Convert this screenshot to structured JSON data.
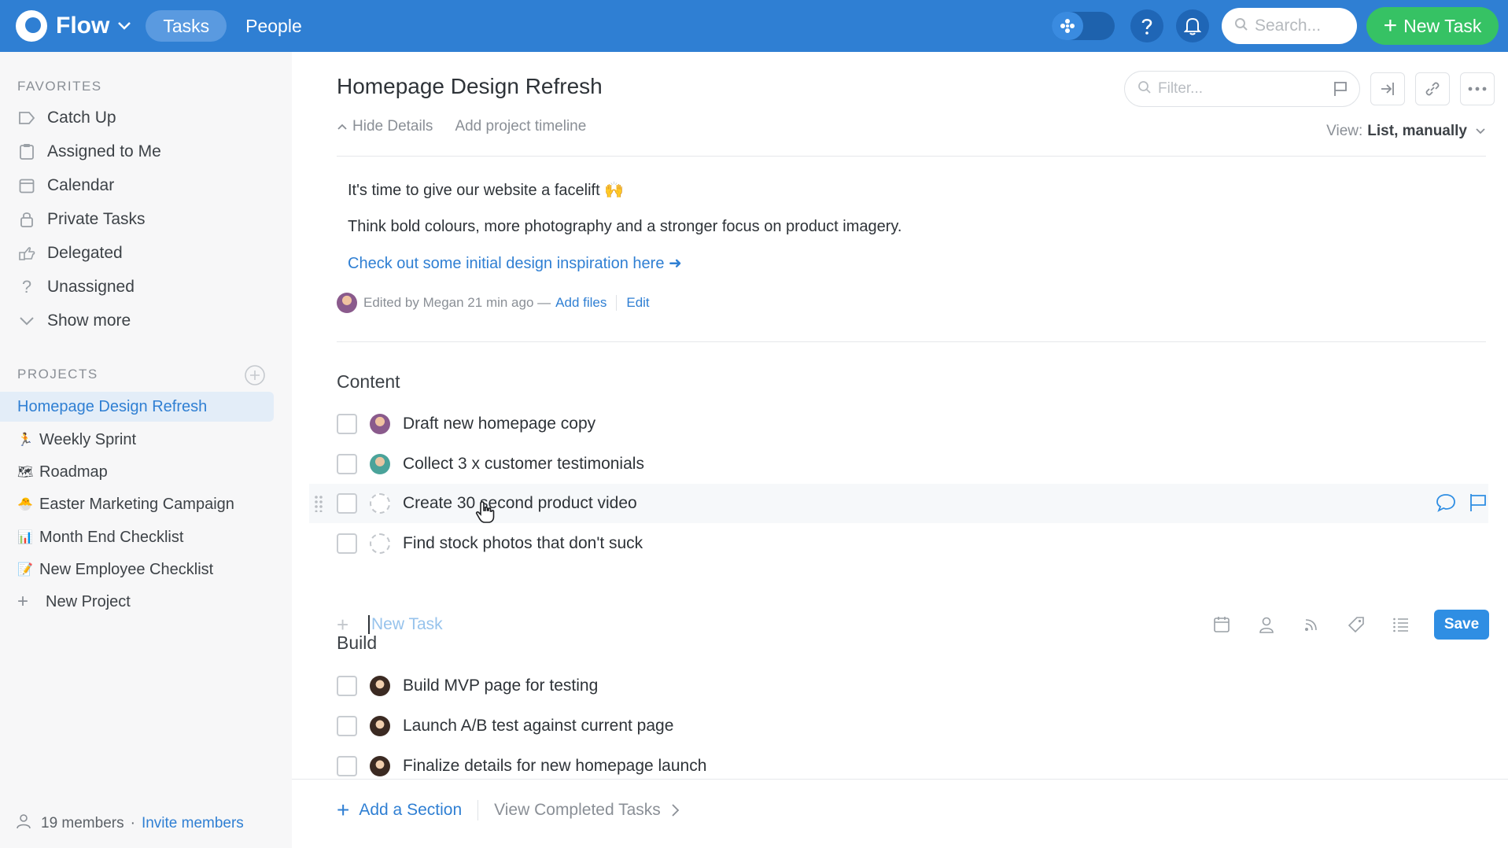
{
  "topbar": {
    "app_name": "Flow",
    "tabs": [
      "Tasks",
      "People"
    ],
    "search_placeholder": "Search...",
    "new_task_label": "New Task"
  },
  "sidebar": {
    "favorites_heading": "FAVORITES",
    "favorites": [
      "Catch Up",
      "Assigned to Me",
      "Calendar",
      "Private Tasks",
      "Delegated",
      "Unassigned",
      "Show more"
    ],
    "projects_heading": "PROJECTS",
    "projects": [
      {
        "label": "Homepage Design Refresh",
        "icon": ""
      },
      {
        "label": "Weekly Sprint",
        "icon": "🏃"
      },
      {
        "label": "Roadmap",
        "icon": "🗺"
      },
      {
        "label": "Easter Marketing Campaign",
        "icon": "🐣"
      },
      {
        "label": "Month End Checklist",
        "icon": "📊"
      },
      {
        "label": "New Employee Checklist",
        "icon": "📝"
      },
      {
        "label": "New Project",
        "icon": "+"
      }
    ],
    "footer": {
      "members": "19 members",
      "dot": "·",
      "invite": "Invite members"
    }
  },
  "main": {
    "title": "Homepage Design Refresh",
    "hide_details": "Hide Details",
    "add_timeline": "Add project timeline",
    "filter_placeholder": "Filter...",
    "view_prefix": "View:",
    "view_value": "List, manually",
    "description": {
      "line1": "It's time to give our website a facelift 🙌",
      "line2": "Think bold colours, more photography and a stronger focus on product imagery.",
      "link": "Check out some initial design inspiration here ➜"
    },
    "edited": {
      "text": "Edited by Megan 21 min ago —",
      "add_files": "Add files",
      "edit": "Edit"
    },
    "sections": [
      {
        "title": "Content",
        "tasks": [
          {
            "title": "Draft new homepage copy",
            "assignee": "megan"
          },
          {
            "title": "Collect 3 x customer testimonials",
            "assignee": "teal"
          },
          {
            "title": "Create 30 second product video",
            "assignee": "none"
          },
          {
            "title": "Find stock photos that don't suck",
            "assignee": "none"
          }
        ]
      },
      {
        "title": "Build",
        "tasks": [
          {
            "title": "Build MVP page for testing",
            "assignee": "girl"
          },
          {
            "title": "Launch A/B test against current page",
            "assignee": "girl"
          },
          {
            "title": "Finalize details for new homepage launch",
            "assignee": "girl"
          }
        ]
      }
    ],
    "new_task_placeholder": "New Task",
    "save_label": "Save",
    "add_section": "Add a Section",
    "view_completed": "View Completed Tasks"
  },
  "colors": {
    "accent": "#2f7fd3",
    "green": "#36c264",
    "sidebar_bg": "#f7f7f8"
  }
}
